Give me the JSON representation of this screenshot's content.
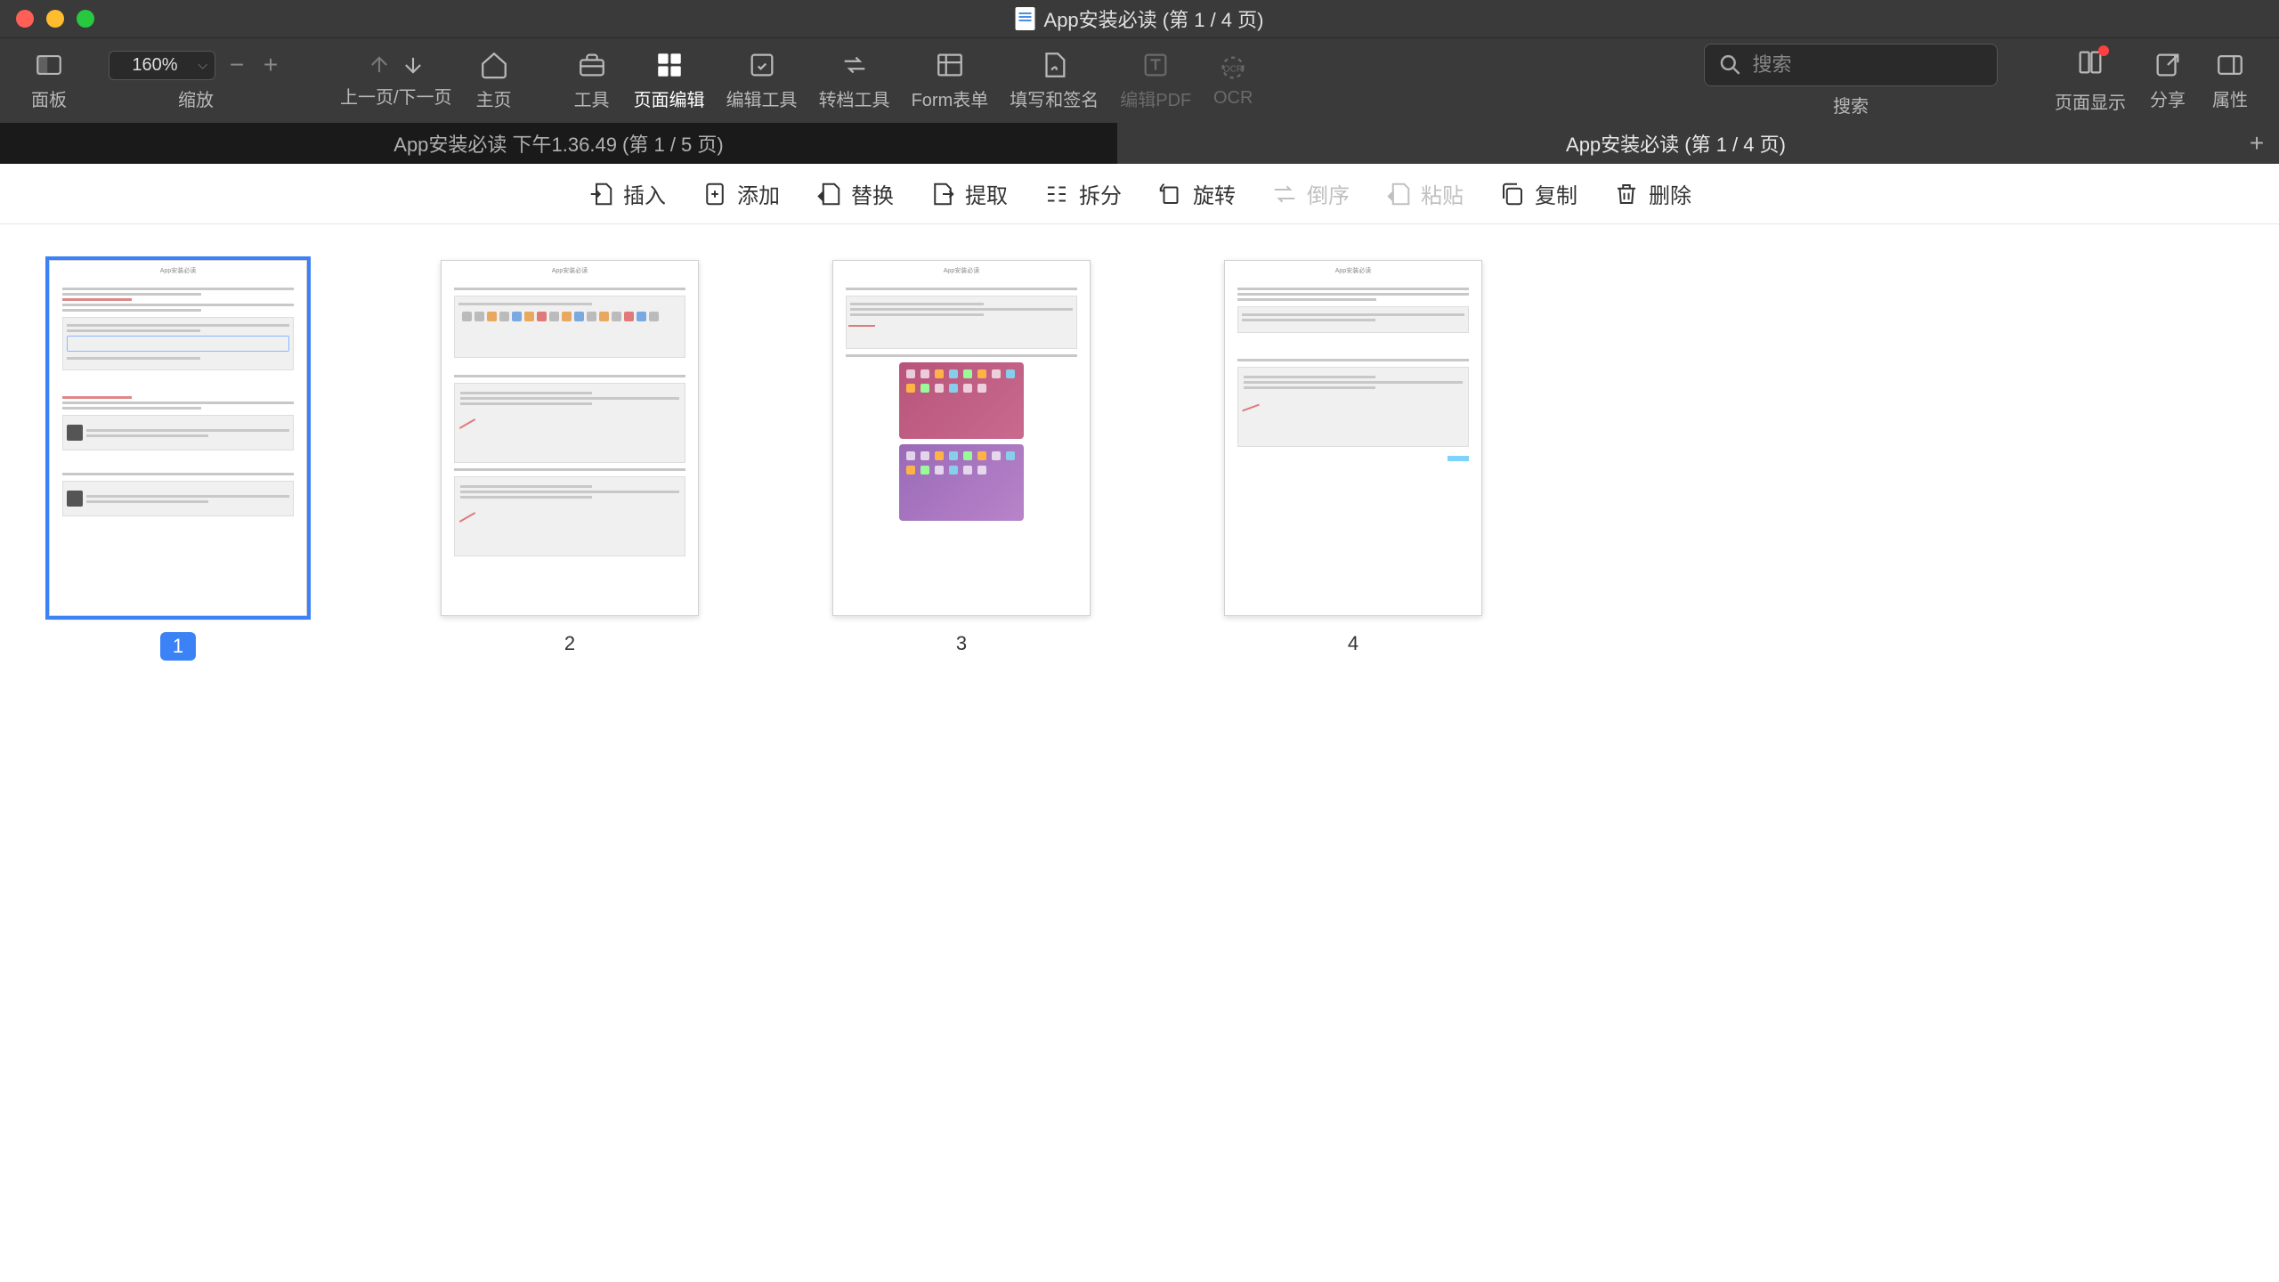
{
  "window": {
    "title": "App安装必读 (第 1 / 4 页)"
  },
  "toolbar": {
    "panel": "面板",
    "zoom_label": "缩放",
    "zoom_value": "160%",
    "nav": "上一页/下一页",
    "home": "主页",
    "tools": "工具",
    "page_edit": "页面编辑",
    "edit_tools": "编辑工具",
    "convert": "转档工具",
    "form": "Form表单",
    "fillsign": "填写和签名",
    "editpdf": "编辑PDF",
    "ocr": "OCR",
    "search_placeholder": "搜索",
    "search_label": "搜索",
    "display": "页面显示",
    "share": "分享",
    "props": "属性"
  },
  "tabs": [
    {
      "label": "App安装必读 下午1.36.49 (第 1 / 5 页)",
      "active": false
    },
    {
      "label": "App安装必读 (第 1 / 4 页)",
      "active": true
    }
  ],
  "subbar": {
    "insert": "插入",
    "add": "添加",
    "replace": "替换",
    "extract": "提取",
    "split": "拆分",
    "rotate": "旋转",
    "reverse": "倒序",
    "paste": "粘贴",
    "copy": "复制",
    "delete": "删除"
  },
  "thumbs": [
    {
      "num": "1",
      "selected": true
    },
    {
      "num": "2",
      "selected": false
    },
    {
      "num": "3",
      "selected": false
    },
    {
      "num": "4",
      "selected": false
    }
  ],
  "page_preview_header": "App安装必读"
}
